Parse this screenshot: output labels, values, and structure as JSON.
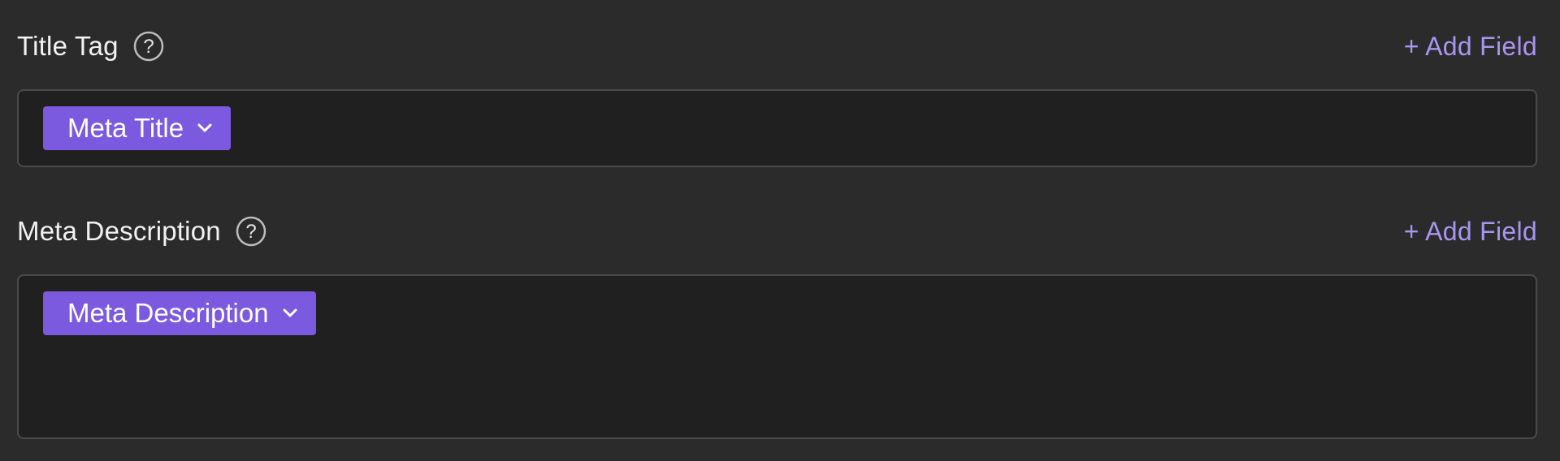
{
  "sections": [
    {
      "label": "Title Tag",
      "help_icon": "question-circle-icon",
      "add_field_label": "+ Add Field",
      "token": {
        "label": "Meta Title",
        "icon": "chevron-down-icon"
      }
    },
    {
      "label": "Meta Description",
      "help_icon": "question-circle-icon",
      "add_field_label": "+ Add Field",
      "token": {
        "label": "Meta Description",
        "icon": "chevron-down-icon"
      }
    }
  ],
  "colors": {
    "background": "#2b2b2b",
    "field_background": "#202020",
    "field_border": "#4a4a4a",
    "token_background": "#7b5ae0",
    "accent_link": "#a796f0",
    "label_text": "#f2f2f2"
  }
}
